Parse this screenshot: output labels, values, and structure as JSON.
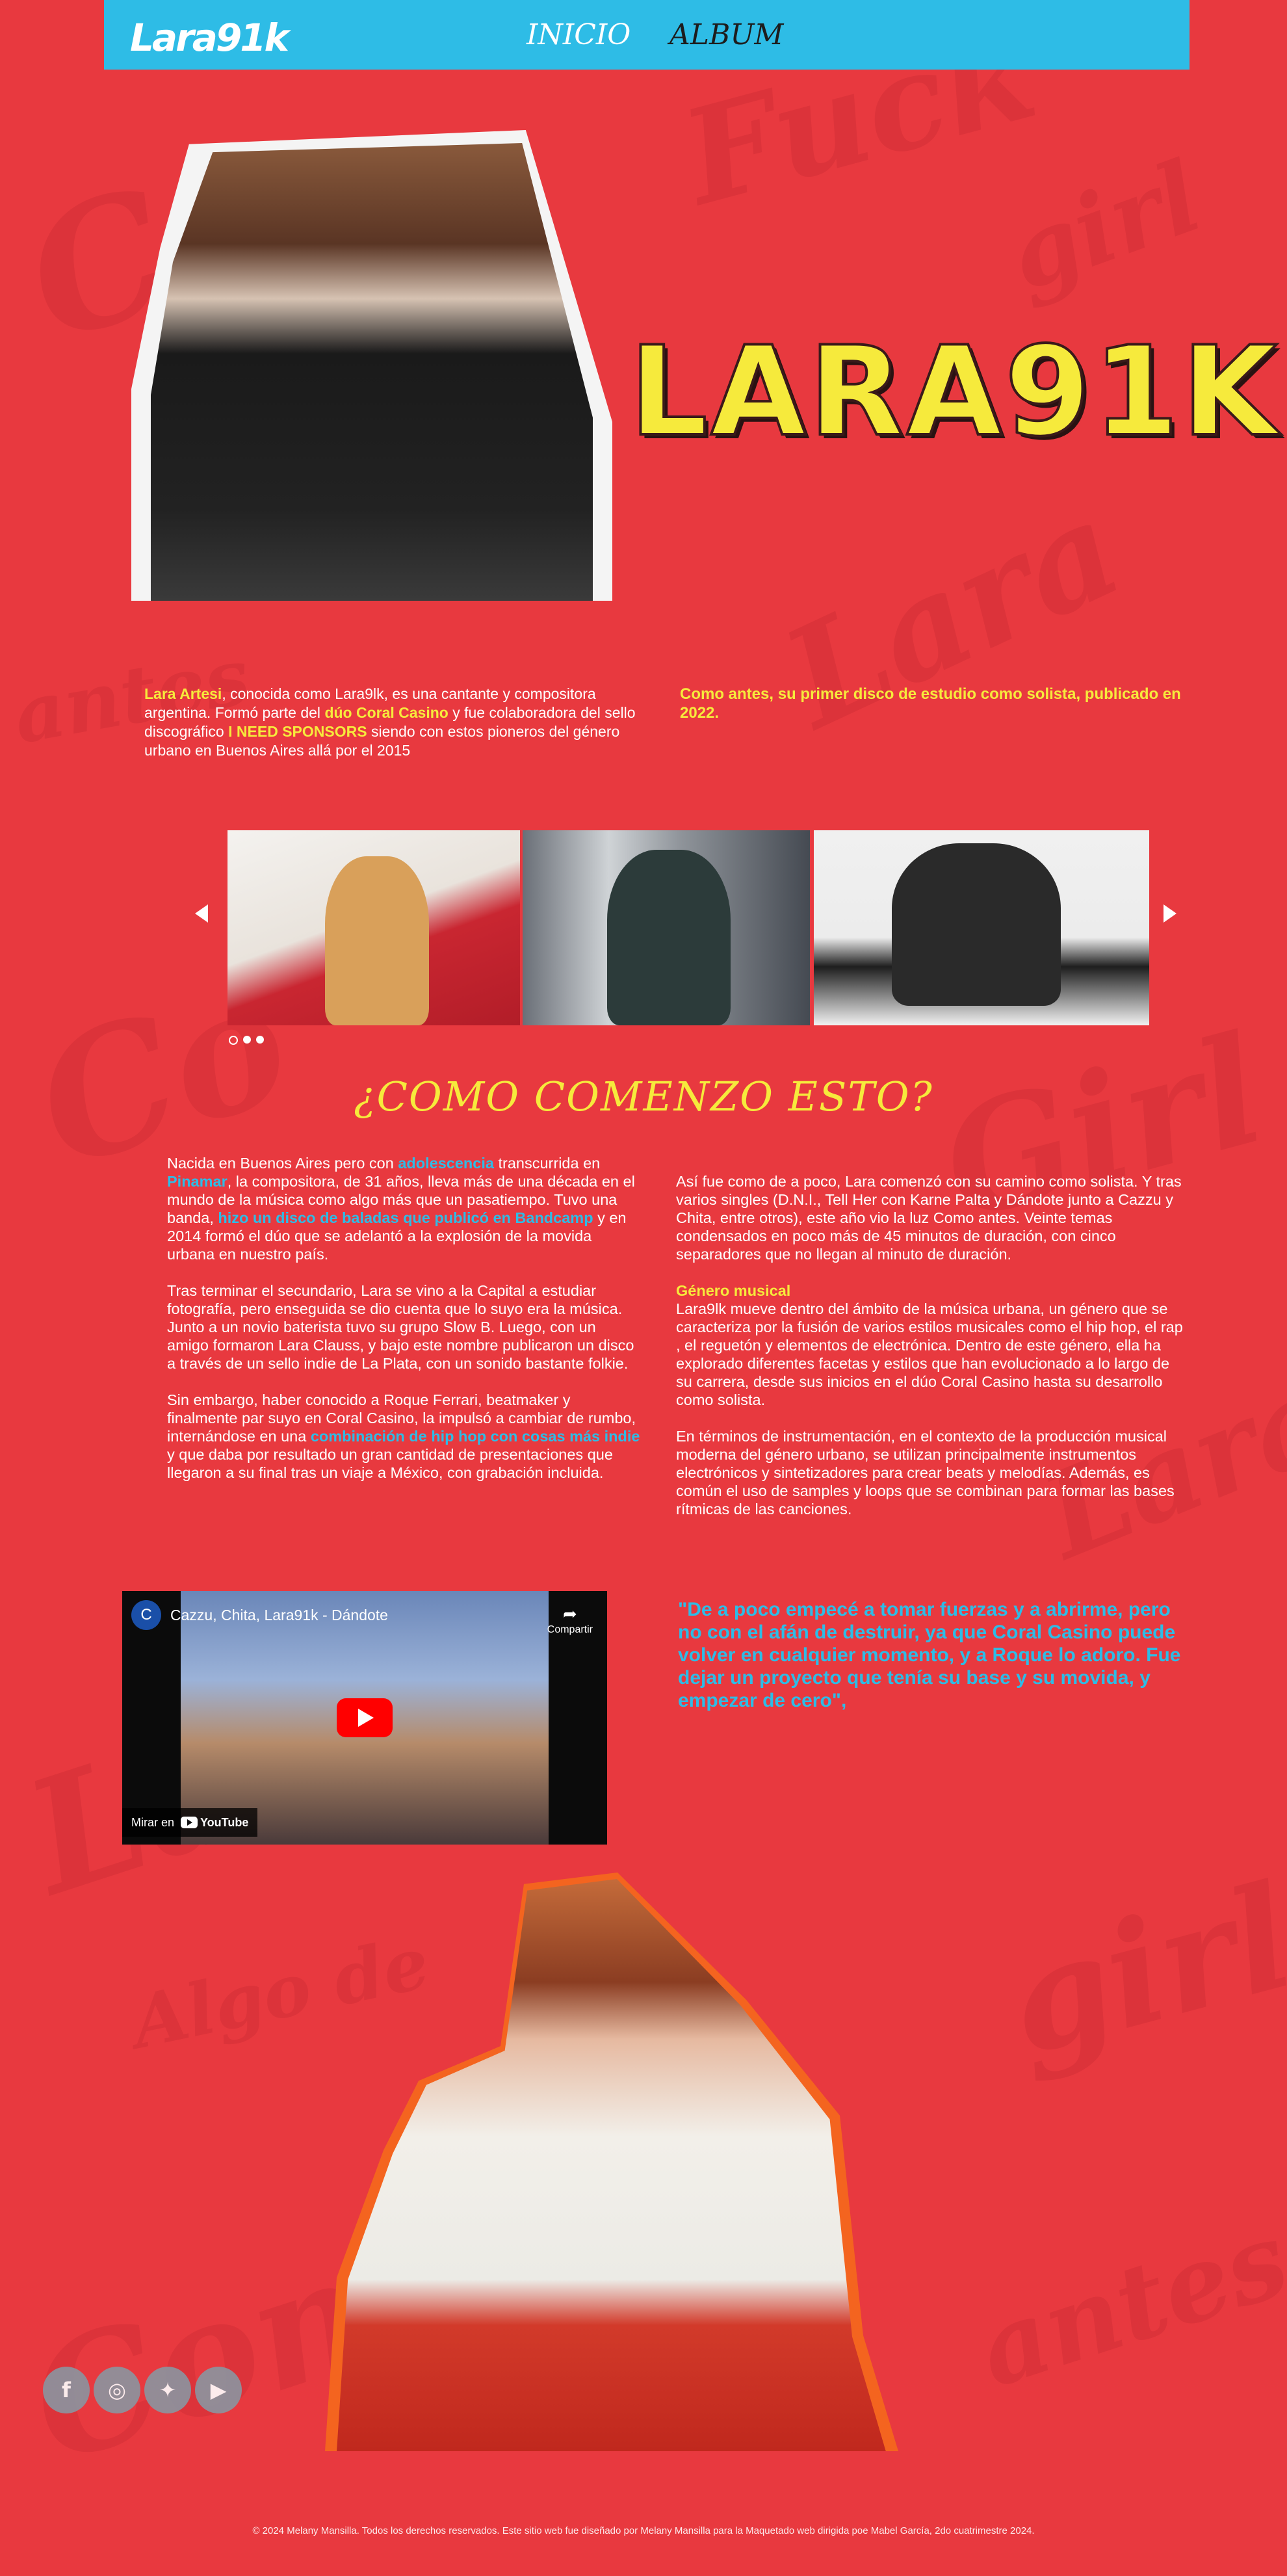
{
  "nav": {
    "logo": "Lara91k",
    "links": [
      {
        "label": "INICIO"
      },
      {
        "label": "ALBUM"
      }
    ]
  },
  "hero": {
    "title": "LARA91K"
  },
  "intro": {
    "left": {
      "name": "Lara Artesi",
      "t1": ", conocida como Lara9lk, es una cantante y compositora argentina. Formó parte del ",
      "duo": "dúo Coral Casino",
      "t2": " y fue colaboradora del sello discográfico ",
      "label": "I NEED SPONSORS",
      "t3": " siendo con estos pioneros del género urbano en Buenos Aires allá por el 2015"
    },
    "right": "Como antes, su primer disco de estudio como solista, publicado en 2022."
  },
  "carousel": {
    "prev_icon": "chevron-left-icon",
    "next_icon": "chevron-right-icon",
    "active_dot": 1
  },
  "section": {
    "title": "¿COMO COMENZO ESTO?",
    "left": {
      "p1_a": "Nacida en Buenos Aires pero con ",
      "p1_link1": "adolescencia",
      "p1_b": " transcurrida en ",
      "p1_link2": "Pinamar",
      "p1_c": ", la compositora, de 31 años, lleva más de una década en el mundo de la música como algo más que un pasatiempo. Tuvo una banda, ",
      "p1_link3": "hizo un disco de baladas que publicó en Bandcamp",
      "p1_d": " y en 2014 formó el dúo que se adelantó a la explosión de la movida urbana en nuestro país.",
      "p2": "Tras terminar el secundario, Lara se vino a la Capital a estudiar fotografía, pero enseguida se dio cuenta que lo suyo era la música. Junto a un novio baterista tuvo su grupo Slow B. Luego, con un amigo formaron Lara Clauss, y bajo este nombre publicaron un disco a través de un sello indie de La Plata, con un sonido bastante folkie.",
      "p3_a": "Sin embargo, haber conocido a Roque Ferrari, beatmaker y finalmente par suyo en Coral Casino, la impulsó a cambiar de rumbo, internándose en una ",
      "p3_link": "combinación de hip hop con cosas más indie",
      "p3_b": " y que daba por resultado un gran cantidad de presentaciones que llegaron a su final tras un viaje a México, con grabación incluida."
    },
    "right": {
      "p1": "Así fue como de a poco, Lara comenzó con su camino como solista. Y tras varios singles (D.N.I., Tell Her con Karne Palta y Dándote junto a Cazzu y Chita, entre otros), este año vio la luz Como antes. Veinte temas condensados en poco más de 45 minutos de duración, con cinco separadores que no llegan al minuto de duración.",
      "genre_heading": "Género musical",
      "p2": "Lara9lk mueve dentro del ámbito de la música urbana, un género que se caracteriza por la fusión de varios estilos musicales como el hip hop, el rap , el reguetón y elementos de electrónica. Dentro de este género, ella ha explorado diferentes facetas y estilos que han evolucionado a lo largo de su carrera, desde sus inicios en el dúo Coral Casino hasta su desarrollo como solista.",
      "p3": "En términos de instrumentación, en el contexto de la producción musical moderna del género urbano, se utilizan principalmente instrumentos electrónicos y sintetizadores para crear beats y melodías. Además, es común el uso de samples y loops que se combinan para formar las bases rítmicas de las canciones."
    },
    "quote": "\"De a poco empecé a tomar fuerzas y a abrirme, pero no con el afán de destruir, ya que Coral Casino puede volver en cualquier momento, y a Roque lo adoro. Fue dejar un proyecto que tenía su base y su movida, y empezar de cero\","
  },
  "video": {
    "channel_initial": "C",
    "title": "Cazzu, Chita, Lara91k - Dándote",
    "share_label": "Compartir",
    "watch_on": "Mirar en",
    "yt_brand": "YouTube"
  },
  "social": [
    {
      "icon": "facebook-icon",
      "glyph": "f"
    },
    {
      "icon": "instagram-icon",
      "glyph": "◎"
    },
    {
      "icon": "twitter-icon",
      "glyph": "✦"
    },
    {
      "icon": "youtube-icon",
      "glyph": "▶"
    }
  ],
  "footer": "© 2024 Melany Mansilla. Todos los derechos reservados. Este sitio web fue diseñado por Melany Mansilla para la Maquetado web dirigida poe Mabel García, 2do cuatrimestre 2024.",
  "colors": {
    "background": "#e8393f",
    "nav": "#2ebce6",
    "accent_yellow": "#f6ea3c",
    "accent_blue": "#2ebce6"
  }
}
